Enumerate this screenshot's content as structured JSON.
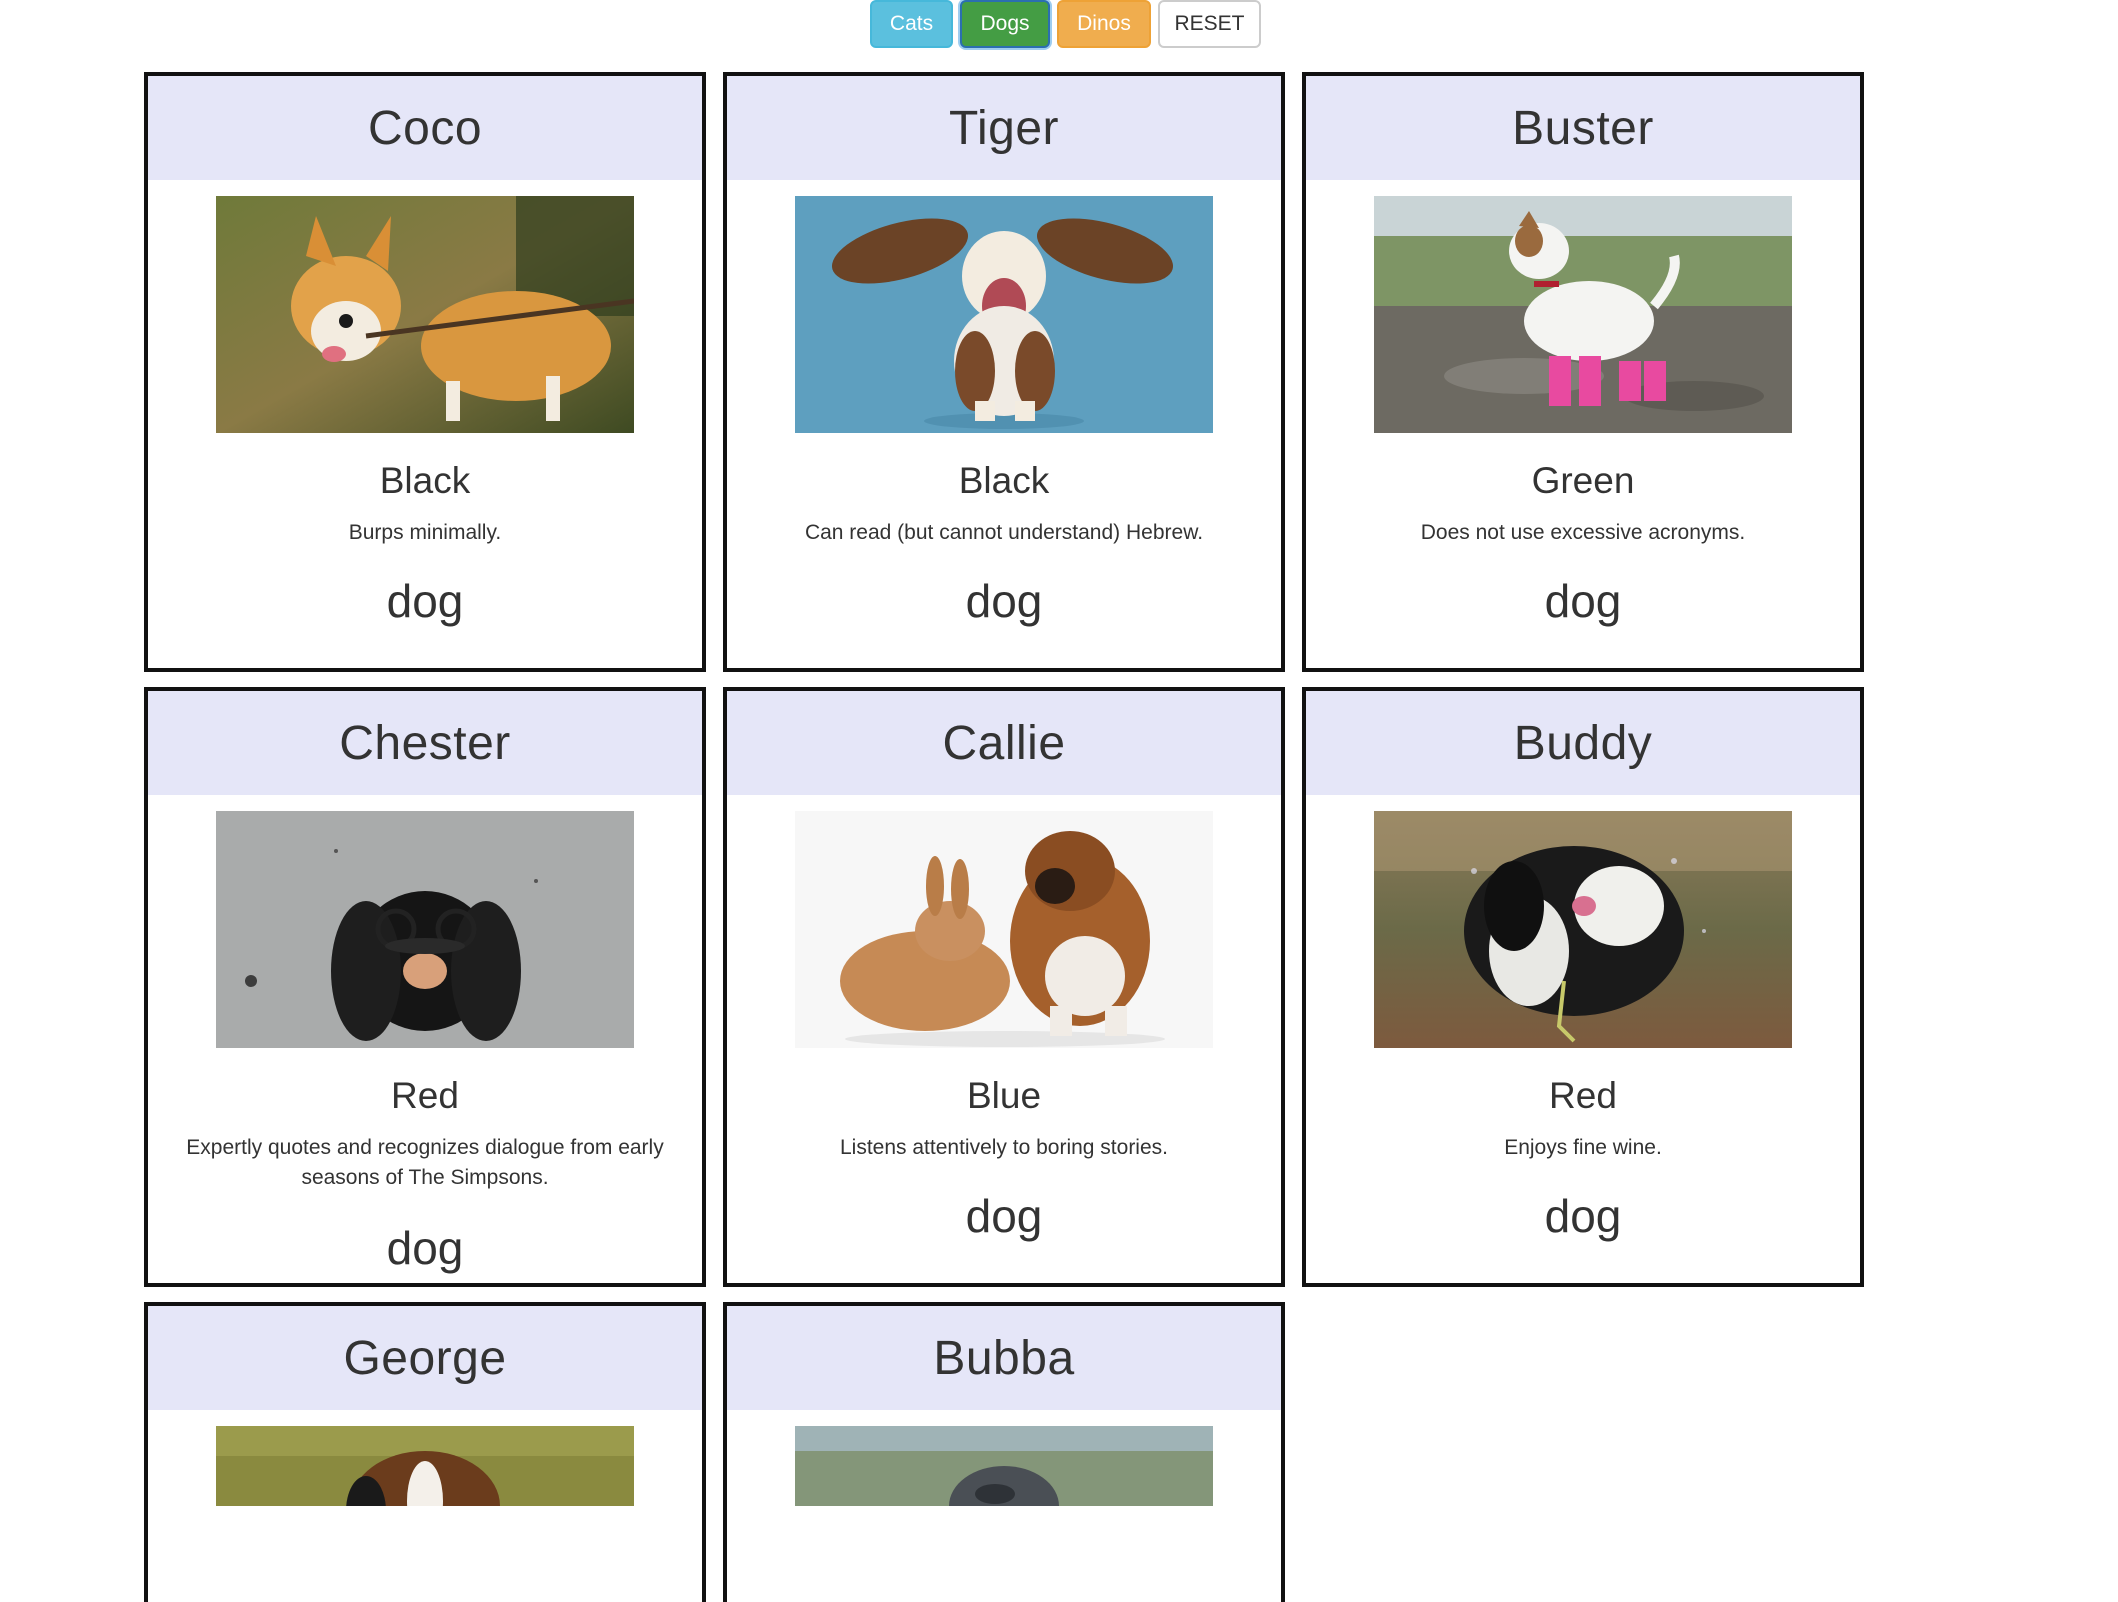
{
  "filters": {
    "cats": "Cats",
    "dogs": "Dogs",
    "dinos": "Dinos",
    "reset": "RESET"
  },
  "cards": [
    {
      "name": "Coco",
      "color": "Black",
      "desc": "Burps minimally.",
      "type": "dog",
      "photo": "corgi-with-stick-photo"
    },
    {
      "name": "Tiger",
      "color": "Black",
      "desc": "Can read (but cannot understand) Hebrew.",
      "type": "dog",
      "photo": "basset-hound-flying-ears-photo"
    },
    {
      "name": "Buster",
      "color": "Green",
      "desc": "Does not use excessive acronyms.",
      "type": "dog",
      "photo": "jack-russell-pink-boots-photo"
    },
    {
      "name": "Chester",
      "color": "Red",
      "desc": "Expertly quotes and recognizes dialogue from early seasons of The Simpsons.",
      "type": "dog",
      "photo": "spaniel-with-disguise-glasses-photo"
    },
    {
      "name": "Callie",
      "color": "Blue",
      "desc": "Listens attentively to boring stories.",
      "type": "dog",
      "photo": "boxer-puppy-and-rabbit-photo"
    },
    {
      "name": "Buddy",
      "color": "Red",
      "desc": "Enjoys fine wine.",
      "type": "dog",
      "photo": "wet-dog-shaking-photo"
    },
    {
      "name": "George",
      "photo": "basset-hound-grass-photo"
    },
    {
      "name": "Bubba",
      "photo": "greyhound-landscape-photo"
    }
  ],
  "colors": {
    "cats_button": "#5bc0de",
    "dogs_button": "#449d44",
    "dinos_button": "#f0ad4e",
    "card_header_bg": "#e5e6f8",
    "card_border": "#111111"
  }
}
